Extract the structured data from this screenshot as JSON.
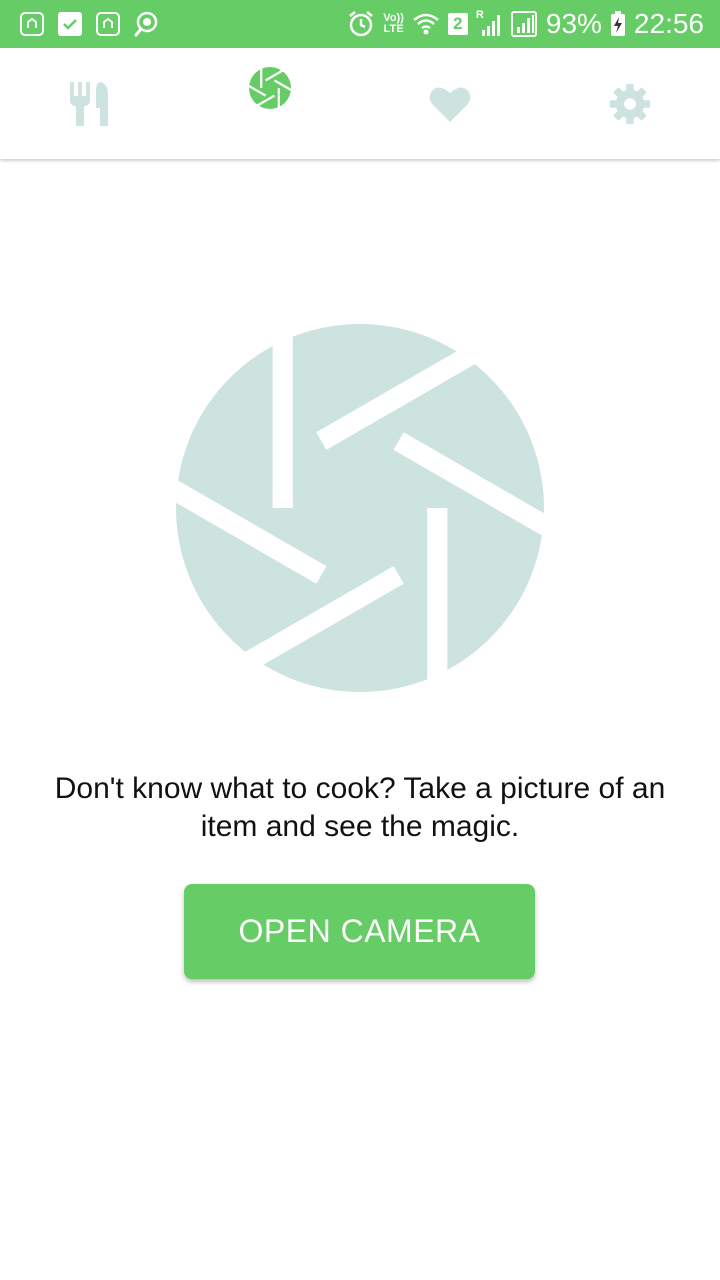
{
  "status_bar": {
    "battery_percent": "93%",
    "time": "22:56",
    "volte_top": "Vo))",
    "volte_bottom": "LTE",
    "sim_badge": "2",
    "roaming_mark": "R"
  },
  "tabs": [
    {
      "name": "food",
      "icon": "fork-knife-icon",
      "active": false
    },
    {
      "name": "camera",
      "icon": "aperture-icon",
      "active": true
    },
    {
      "name": "favorites",
      "icon": "heart-icon",
      "active": false
    },
    {
      "name": "settings",
      "icon": "gear-icon",
      "active": false
    }
  ],
  "colors": {
    "accent": "#66cc66",
    "icon_inactive": "#cde3df",
    "text": "#111111"
  },
  "main": {
    "hero_icon": "aperture-icon",
    "message": "Don't know what to cook? Take a picture of an item and see the magic.",
    "button_label": "OPEN CAMERA"
  }
}
